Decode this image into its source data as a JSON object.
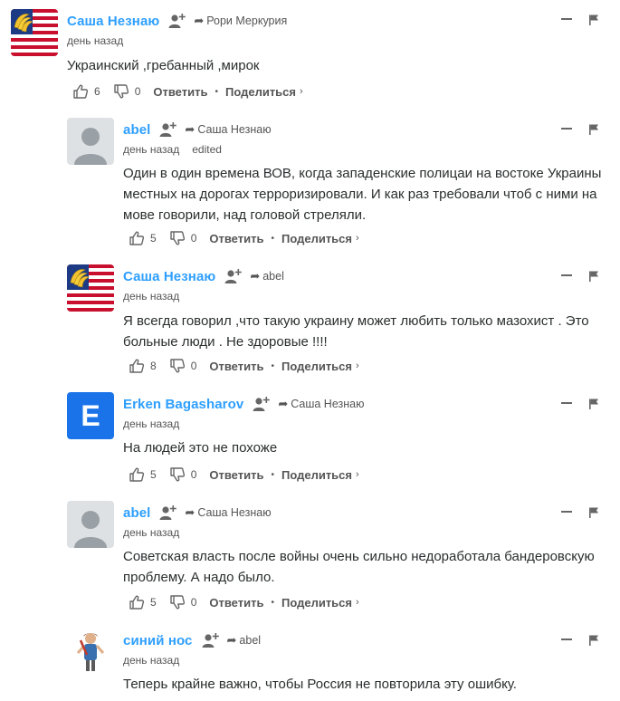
{
  "colors": {
    "author": "#2e9fff",
    "text": "#2a2e2e",
    "muted": "#555555",
    "letter_avatar_bg": "#1a73e8"
  },
  "labels": {
    "reply": "Ответить",
    "share": "Поделиться",
    "chevron": "›",
    "dot": "•",
    "arrow": "➦"
  },
  "comments": [
    {
      "author": "Саша Незнаю",
      "reply_to": "Рори Меркурия",
      "time": "день назад",
      "edited": "",
      "text": "Украинский ,гребанный ,мирок",
      "likes": "6",
      "dislikes": "0",
      "avatar": "flag-bananas-avatar"
    },
    {
      "author": "abel",
      "reply_to": "Саша Незнаю",
      "time": "день назад",
      "edited": "edited",
      "text": "Один в один времена ВОВ, когда западенские полицаи на востоке Украины местных на дорогах терроризировали. И как раз требовали чтоб с ними на мове говорили, над головой стреляли.",
      "likes": "5",
      "dislikes": "0",
      "avatar": "default-avatar"
    },
    {
      "author": "Саша Незнаю",
      "reply_to": "abel",
      "time": "день назад",
      "edited": "",
      "text": "Я всегда говорил ,что такую украину может любить только мазохист . Это больные люди . Не здоровые !!!!",
      "likes": "8",
      "dislikes": "0",
      "avatar": "flag-bananas-avatar"
    },
    {
      "author": "Erken Bagasharov",
      "reply_to": "Саша Незнаю",
      "time": "день назад",
      "edited": "",
      "text": "На людей это не похоже",
      "likes": "5",
      "dislikes": "0",
      "avatar": "letter-avatar",
      "avatar_letter": "E"
    },
    {
      "author": "abel",
      "reply_to": "Саша Незнаю",
      "time": "день назад",
      "edited": "",
      "text": "Советская власть после войны очень сильно недоработала бандеровскую проблему. А надо было.",
      "likes": "5",
      "dislikes": "0",
      "avatar": "default-avatar"
    },
    {
      "author": "синий нос",
      "reply_to": "abel",
      "time": "день назад",
      "edited": "",
      "text": "Теперь крайне важно, чтобы Россия не повторила эту ошибку.",
      "likes": "",
      "dislikes": "",
      "avatar": "illustration-avatar"
    }
  ]
}
